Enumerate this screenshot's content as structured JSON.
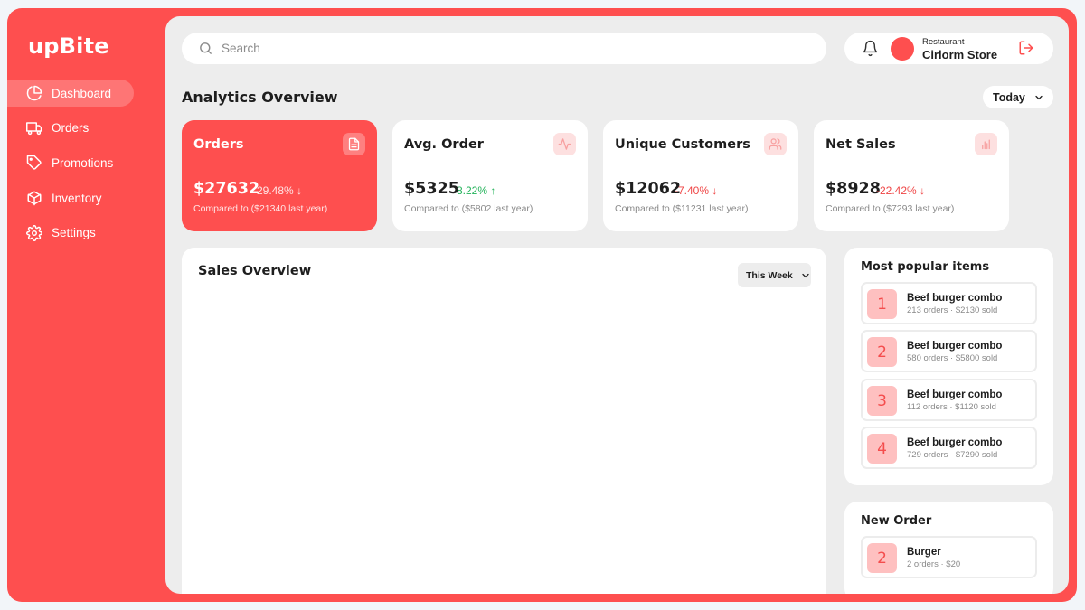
{
  "brand": {
    "name": "upBite",
    "accent": "#fe4f4f"
  },
  "nav": [
    {
      "label": "Dashboard",
      "icon": "pie-chart-icon",
      "active": true
    },
    {
      "label": "Orders",
      "icon": "truck-icon",
      "active": false
    },
    {
      "label": "Promotions",
      "icon": "tag-icon",
      "active": false
    },
    {
      "label": "Inventory",
      "icon": "box-icon",
      "active": false
    },
    {
      "label": "Settings",
      "icon": "gear-icon",
      "active": false
    }
  ],
  "search": {
    "placeholder": "Search",
    "value": ""
  },
  "profile": {
    "label": "Restaurant",
    "name": "Cirlorm Store"
  },
  "analytics": {
    "title": "Analytics Overview",
    "period": "Today"
  },
  "stats": [
    {
      "title": "Orders",
      "value": "$27632",
      "change": "-29.48%",
      "direction": "down",
      "compare": "Compared to ($21340 last year)",
      "icon": "document-icon",
      "highlight": true
    },
    {
      "title": "Avg. Order",
      "value": "$5325",
      "change": "8.22%",
      "direction": "up",
      "compare": "Compared to ($5802 last year)",
      "icon": "activity-icon",
      "highlight": false
    },
    {
      "title": "Unique Customers",
      "value": "$12062",
      "change": "-7.40%",
      "direction": "down",
      "compare": "Compared to ($11231 last year)",
      "icon": "users-icon",
      "highlight": false
    },
    {
      "title": "Net Sales",
      "value": "$8928",
      "change": "-22.42%",
      "direction": "down",
      "compare": "Compared to ($7293 last year)",
      "icon": "bar-chart-icon",
      "highlight": false
    }
  ],
  "sales": {
    "title": "Sales Overview",
    "period": "This Week"
  },
  "popular": {
    "title": "Most popular items",
    "items": [
      {
        "rank": "1",
        "name": "Beef burger combo",
        "meta": "213 orders · $2130 sold"
      },
      {
        "rank": "2",
        "name": "Beef burger combo",
        "meta": "580 orders · $5800 sold"
      },
      {
        "rank": "3",
        "name": "Beef burger combo",
        "meta": "112 orders · $1120 sold"
      },
      {
        "rank": "4",
        "name": "Beef burger combo",
        "meta": "729 orders · $7290 sold"
      }
    ]
  },
  "new_order": {
    "title": "New Order",
    "items": [
      {
        "rank": "2",
        "name": "Burger",
        "meta": "2 orders · $20"
      }
    ]
  }
}
